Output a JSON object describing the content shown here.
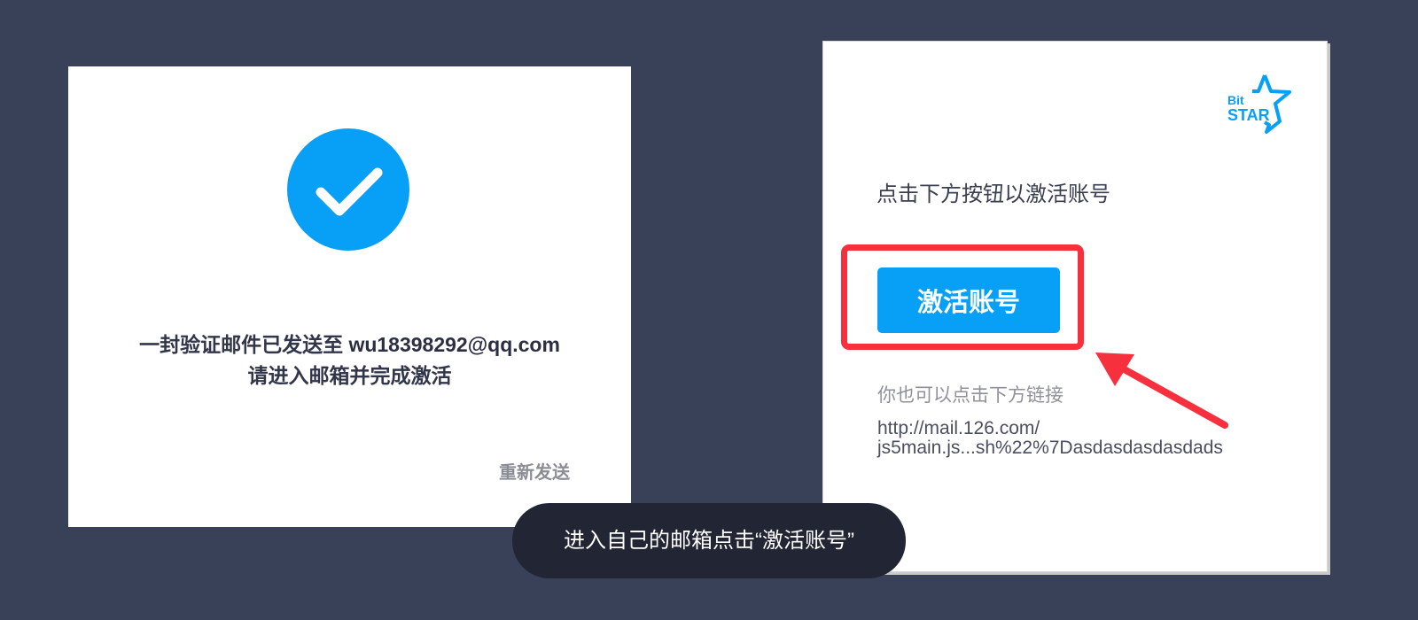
{
  "left_card": {
    "sent_prefix": "一封验证邮件已发送至 ",
    "email": "wu18398292@qq.com",
    "enter_text": "请进入邮箱并完成激活",
    "resend_label": "重新发送"
  },
  "right_card": {
    "logo": {
      "line1": "Bit",
      "line2": "STAR"
    },
    "instruction": "点击下方按钮以激活账号",
    "activate_label": "激活账号",
    "alt_text": "你也可以点击下方链接",
    "link_line1": "http://mail.126.com/",
    "link_line2": "js5main.js...sh%22%7Dasdasdasdasdads"
  },
  "tooltip": {
    "text": "进入自己的邮箱点击“激活账号”"
  },
  "colors": {
    "background": "#394159",
    "accent": "#07a0f6",
    "highlight": "#f7303e",
    "tooltip": "#222533"
  },
  "icons": {
    "success": "checkmark-icon",
    "pointer": "red-arrow-icon",
    "brand": "bitstar-logo"
  }
}
